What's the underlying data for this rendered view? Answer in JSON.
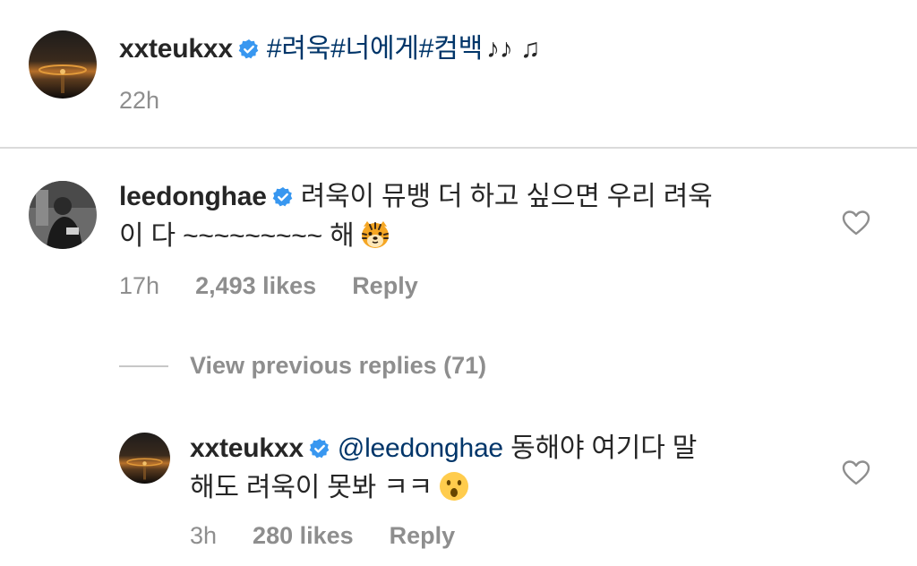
{
  "post": {
    "username": "xxteukxx",
    "caption": "#려욱#너에게#컴백",
    "caption_notes": "♪♪ ♫",
    "time": "22h"
  },
  "comment": {
    "username": "leedonghae",
    "text_line1": "려욱이 뮤뱅 더 하고 싶으면 우리 려욱",
    "text_line2": "이 다 ~~~~~~~~~ 해",
    "emoji": "tiger-face",
    "time": "17h",
    "likes": "2,493 likes",
    "reply_label": "Reply"
  },
  "view_previous": "View previous replies (71)",
  "reply": {
    "username": "xxteukxx",
    "mention": "@leedonghae",
    "text_line1": "동해야 여기다 말",
    "text_line2": "해도 려욱이 못봐 ㅋㅋ",
    "emoji": "surprised-face",
    "time": "3h",
    "likes": "280 likes",
    "reply_label": "Reply"
  },
  "colors": {
    "text": "#262626",
    "link": "#003569",
    "meta": "#8e8e8e",
    "verified": "#3897f0",
    "divider": "#dbdbdb"
  }
}
